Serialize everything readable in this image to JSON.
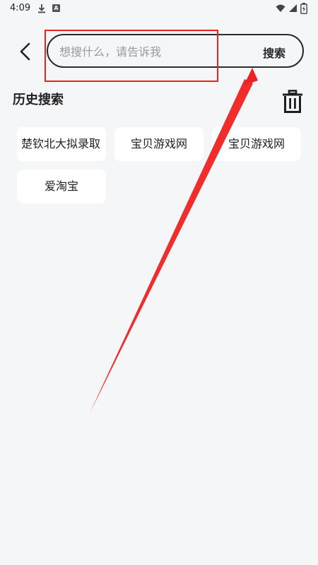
{
  "status_bar": {
    "time": "4:09",
    "icons": [
      "download-icon",
      "a-notification-icon",
      "wifi-icon",
      "signal-icon",
      "battery-icon"
    ]
  },
  "header": {
    "back_icon": "chevron-left-icon",
    "search": {
      "placeholder": "想搜什么，请告诉我",
      "value": "",
      "button_label": "搜索"
    }
  },
  "history": {
    "title": "历史搜索",
    "clear_icon": "trash-icon",
    "items": [
      {
        "label": "楚钦北大拟录取"
      },
      {
        "label": "宝贝游戏网"
      },
      {
        "label": "宝贝游戏网"
      },
      {
        "label": "爱淘宝"
      }
    ]
  },
  "annotation": {
    "highlight_color": "#ee2222"
  }
}
